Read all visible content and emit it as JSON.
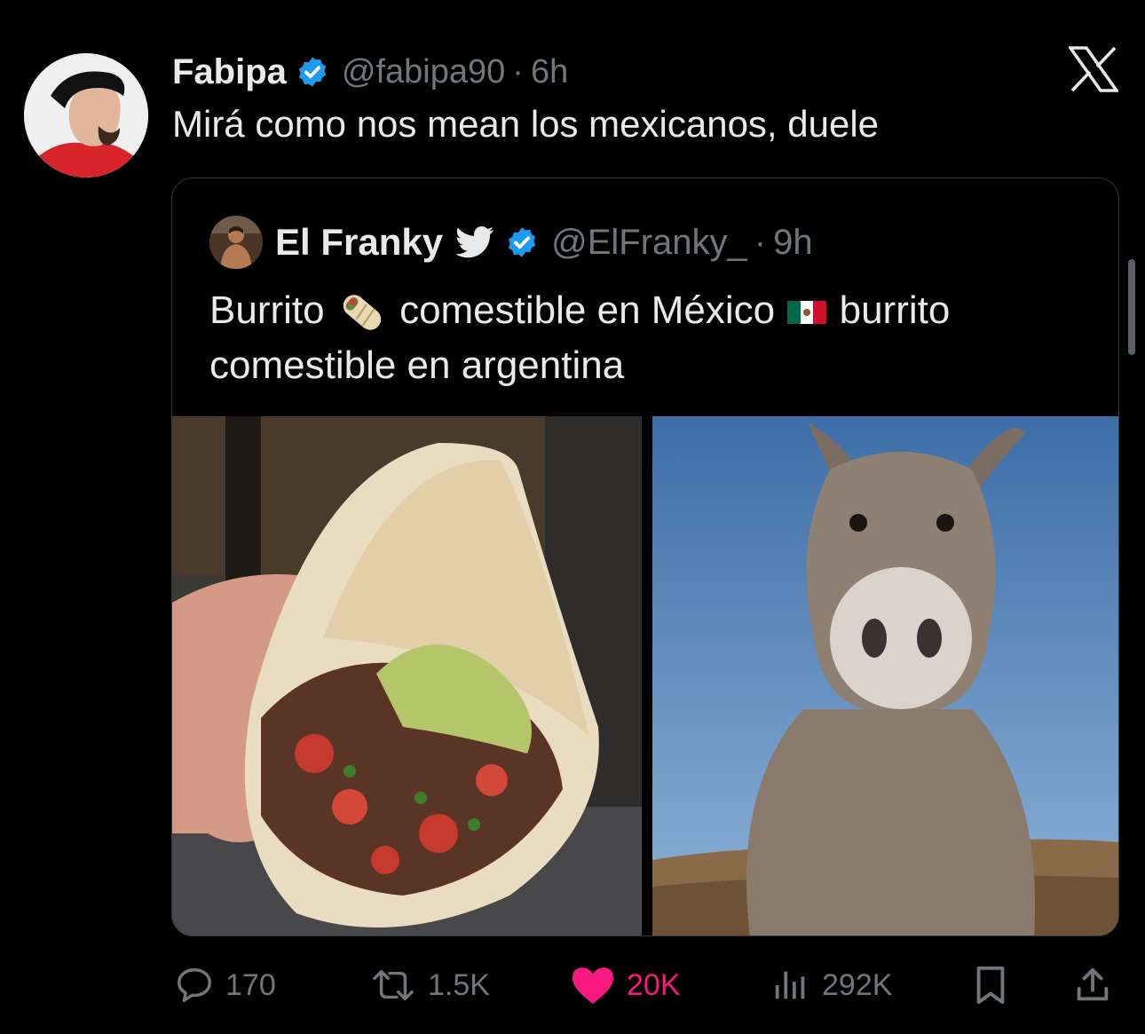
{
  "tweet": {
    "author_name": "Fabipa",
    "handle": "@fabipa90",
    "separator": "·",
    "time": "6h",
    "text": "Mirá como nos mean los mexicanos, duele"
  },
  "quote": {
    "author_name": "El Franky",
    "handle": "@ElFranky_",
    "separator": "·",
    "time": "9h",
    "text_part1": "Burrito",
    "text_part2": "comestible en México",
    "text_part3": "burrito comestible en argentina",
    "images": [
      {
        "alt": "burrito-food-photo"
      },
      {
        "alt": "donkey-photo"
      }
    ]
  },
  "actions": {
    "replies": "170",
    "reposts": "1.5K",
    "likes": "20K",
    "views": "292K"
  },
  "colors": {
    "verified_blue": "#1d9bf0",
    "like_pink": "#f91880",
    "muted_gray": "#71767b",
    "text": "#e7e9ea"
  }
}
